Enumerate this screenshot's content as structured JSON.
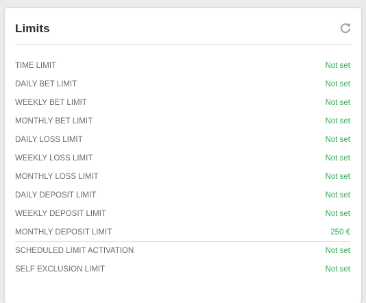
{
  "panel": {
    "title": "Limits",
    "refresh_icon": "refresh-icon"
  },
  "colors": {
    "value_green": "#2fa84f",
    "label_gray": "#6b6b6b"
  },
  "limits": [
    {
      "label": "TIME LIMIT",
      "value": "Not set"
    },
    {
      "label": "DAILY BET LIMIT",
      "value": "Not set"
    },
    {
      "label": "WEEKLY BET LIMIT",
      "value": "Not set"
    },
    {
      "label": "MONTHLY BET LIMIT",
      "value": "Not set"
    },
    {
      "label": "DAILY LOSS LIMIT",
      "value": "Not set"
    },
    {
      "label": "WEEKLY LOSS LIMIT",
      "value": "Not set"
    },
    {
      "label": "MONTHLY LOSS LIMIT",
      "value": "Not set"
    },
    {
      "label": "DAILY DEPOSIT LIMIT",
      "value": "Not set"
    },
    {
      "label": "WEEKLY DEPOSIT LIMIT",
      "value": "Not set"
    },
    {
      "label": "MONTHLY DEPOSIT LIMIT",
      "value": "250 €"
    },
    {
      "label": "SCHEDULED LIMIT ACTIVATION",
      "value": "Not set"
    },
    {
      "label": "SELF EXCLUSION LIMIT",
      "value": "Not set"
    }
  ]
}
